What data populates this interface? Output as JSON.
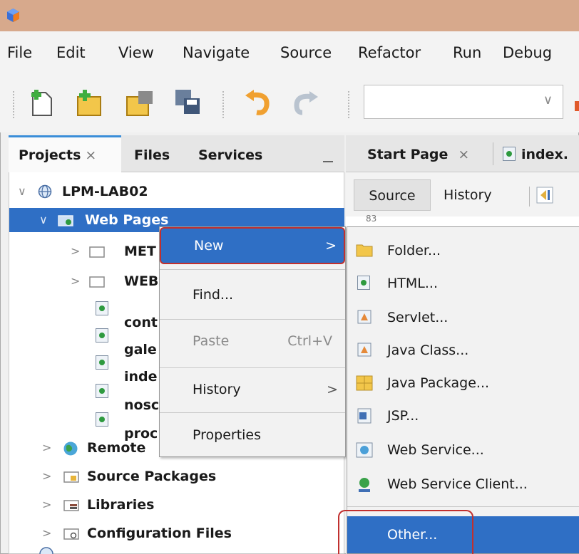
{
  "menubar": {
    "items": [
      "File",
      "Edit",
      "View",
      "Navigate",
      "Source",
      "Refactor",
      "Run",
      "Debug"
    ]
  },
  "toolbar": {
    "icons": [
      "new-file-icon",
      "new-project-icon",
      "open-project-icon",
      "save-all-icon",
      "undo-icon",
      "redo-icon"
    ],
    "combo_arrow": "∨"
  },
  "panel": {
    "tabs": [
      {
        "label": "Projects",
        "close": "×"
      },
      {
        "label": "Files"
      },
      {
        "label": "Services"
      }
    ],
    "tree": [
      {
        "label": "LPM-LAB02",
        "chevron": "∨"
      },
      {
        "label": "Web Pages",
        "chevron": "∨"
      },
      {
        "label": "MET",
        "chevron": ">"
      },
      {
        "label": "WEB",
        "chevron": ">"
      },
      {
        "label": "cont"
      },
      {
        "label": "gale"
      },
      {
        "label": "inde"
      },
      {
        "label": "nosc"
      },
      {
        "label": "proc"
      },
      {
        "label": "Remote",
        "chevron": ">"
      },
      {
        "label": "Source Packages",
        "chevron": ">"
      },
      {
        "label": "Libraries",
        "chevron": ">"
      },
      {
        "label": "Configuration Files",
        "chevron": ">"
      }
    ]
  },
  "editor": {
    "tabs": [
      {
        "label": "Start Page",
        "close": "×"
      },
      {
        "label": "index."
      }
    ],
    "source_label": "Source",
    "history_label": "History",
    "line_number": "83"
  },
  "context_menu": {
    "items": [
      {
        "label": "New",
        "arrow": ">"
      },
      {
        "label": "Find..."
      },
      {
        "label": "Paste",
        "shortcut": "Ctrl+V"
      },
      {
        "label": "History",
        "arrow": ">"
      },
      {
        "label": "Properties"
      }
    ]
  },
  "submenu": {
    "items": [
      {
        "label": "Folder...",
        "icon": "folder-icon"
      },
      {
        "label": "HTML...",
        "icon": "html-file-icon"
      },
      {
        "label": "Servlet...",
        "icon": "servlet-icon"
      },
      {
        "label": "Java Class...",
        "icon": "java-class-icon"
      },
      {
        "label": "Java Package...",
        "icon": "java-package-icon"
      },
      {
        "label": "JSP...",
        "icon": "jsp-icon"
      },
      {
        "label": "Web Service...",
        "icon": "web-service-icon"
      },
      {
        "label": "Web Service Client...",
        "icon": "web-service-client-icon"
      },
      {
        "label": "Other...",
        "icon": ""
      }
    ]
  },
  "colors": {
    "selection": "#2f6fc5",
    "highlight_outline": "#c0302f",
    "titlebar": "#d7a98c"
  }
}
